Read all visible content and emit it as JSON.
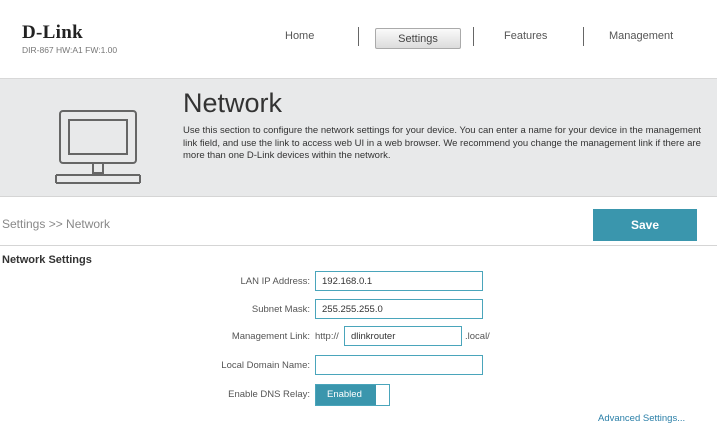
{
  "header": {
    "logo": "D-Link",
    "device_info": "DIR-867 HW:A1 FW:1.00",
    "nav": [
      {
        "label": "Home"
      },
      {
        "label": "Settings",
        "active": true
      },
      {
        "label": "Features"
      },
      {
        "label": "Management"
      }
    ]
  },
  "banner": {
    "title": "Network",
    "description": "Use this section to configure the network settings for your device. You can enter a name for your device in the management link field, and use the link to access web UI in a web browser. We recommend you change the management link if there are more than one D-Link devices within the network.",
    "icon": "computer-network-icon"
  },
  "breadcrumb": "Settings >> Network",
  "save_label": "Save",
  "section_title": "Network Settings",
  "form": {
    "lan_ip": {
      "label": "LAN IP Address:",
      "value": "192.168.0.1"
    },
    "subnet": {
      "label": "Subnet Mask:",
      "value": "255.255.255.0"
    },
    "mgmt": {
      "label": "Management Link:",
      "prefix": "http://",
      "value": "dlinkrouter",
      "suffix": ".local/"
    },
    "domain": {
      "label": "Local Domain Name:",
      "value": ""
    },
    "dns": {
      "label": "Enable DNS Relay:",
      "state": "Enabled"
    }
  },
  "advanced_link": "Advanced Settings...",
  "colors": {
    "accent": "#3a96ad",
    "banner_bg": "#e8e9ea"
  }
}
